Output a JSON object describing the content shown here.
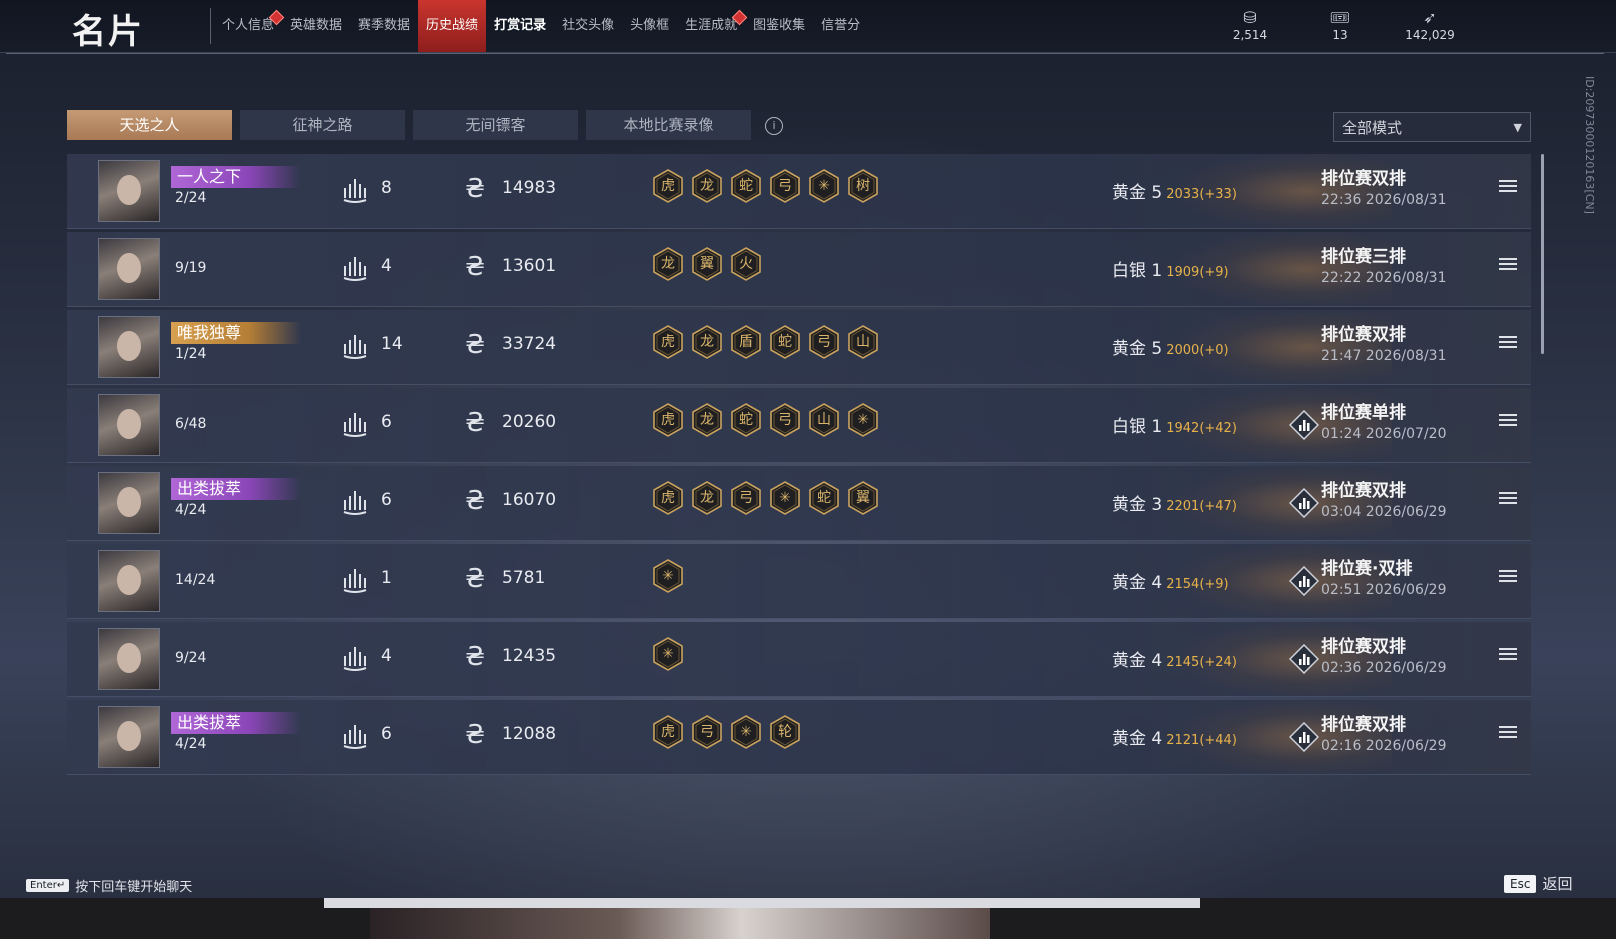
{
  "header": {
    "title": "名片",
    "nav": [
      {
        "label": "个人信息",
        "dot": true
      },
      {
        "label": "英雄数据",
        "dot": false
      },
      {
        "label": "赛季数据",
        "dot": false
      },
      {
        "label": "历史战绩",
        "dot": false,
        "active": true
      },
      {
        "label": "打赏记录",
        "dot": false
      },
      {
        "label": "社交头像",
        "dot": false
      },
      {
        "label": "头像框",
        "dot": false
      },
      {
        "label": "生涯成就",
        "dot": true
      },
      {
        "label": "图鉴收集",
        "dot": false
      },
      {
        "label": "信誉分",
        "dot": false
      }
    ],
    "currencies": [
      {
        "icon": "coin-icon",
        "value": "2,514"
      },
      {
        "icon": "ticket-icon",
        "value": "13"
      },
      {
        "icon": "feather-icon",
        "value": "142,029"
      }
    ]
  },
  "side_id": "ID:2097300012016​3[CN]",
  "tabs": [
    "天选之人",
    "征神之路",
    "无间镖客",
    "本地比赛录像"
  ],
  "mode_select": {
    "value": "全部模式"
  },
  "matches": [
    {
      "title": "一人之下",
      "title_style": "purple",
      "placement": "2/24",
      "kills": "8",
      "gold": "14983",
      "badges": [
        "虎",
        "龙",
        "蛇",
        "弓",
        "✳",
        "树"
      ],
      "rank": "黄金 5",
      "delta": "2033(+33)",
      "mode": "排位赛双排",
      "time": "22:36  2026/08/31",
      "stats": false
    },
    {
      "title": "",
      "title_style": "",
      "placement": "9/19",
      "kills": "4",
      "gold": "13601",
      "badges": [
        "龙",
        "翼",
        "火"
      ],
      "rank": "白银 1",
      "delta": "1909(+9)",
      "mode": "排位赛三排",
      "time": "22:22  2026/08/31",
      "stats": false
    },
    {
      "title": "唯我独尊",
      "title_style": "gold",
      "placement": "1/24",
      "kills": "14",
      "gold": "33724",
      "badges": [
        "虎",
        "龙",
        "盾",
        "蛇",
        "弓",
        "山"
      ],
      "rank": "黄金 5",
      "delta": "2000(+0)",
      "mode": "排位赛双排",
      "time": "21:47  2026/08/31",
      "stats": false
    },
    {
      "title": "",
      "title_style": "",
      "placement": "6/48",
      "kills": "6",
      "gold": "20260",
      "badges": [
        "虎",
        "龙",
        "蛇",
        "弓",
        "山",
        "✳"
      ],
      "rank": "白银 1",
      "delta": "1942(+42)",
      "mode": "排位赛单排",
      "time": "01:24  2026/07/20",
      "stats": true
    },
    {
      "title": "出类拔萃",
      "title_style": "purple",
      "placement": "4/24",
      "kills": "6",
      "gold": "16070",
      "badges": [
        "虎",
        "龙",
        "弓",
        "✳",
        "蛇",
        "翼"
      ],
      "rank": "黄金 3",
      "delta": "2201(+47)",
      "mode": "排位赛双排",
      "time": "03:04  2026/06/29",
      "stats": true
    },
    {
      "title": "",
      "title_style": "",
      "placement": "14/24",
      "kills": "1",
      "gold": "5781",
      "badges": [
        "✳"
      ],
      "rank": "黄金 4",
      "delta": "2154(+9)",
      "mode": "排位赛·双排",
      "time": "02:51  2026/06/29",
      "stats": true
    },
    {
      "title": "",
      "title_style": "",
      "placement": "9/24",
      "kills": "4",
      "gold": "12435",
      "badges": [
        "✳"
      ],
      "rank": "黄金 4",
      "delta": "2145(+24)",
      "mode": "排位赛双排",
      "time": "02:36  2026/06/29",
      "stats": true
    },
    {
      "title": "出类拔萃",
      "title_style": "purple",
      "placement": "4/24",
      "kills": "6",
      "gold": "12088",
      "badges": [
        "虎",
        "弓",
        "✳",
        "轮"
      ],
      "rank": "黄金 4",
      "delta": "2121(+44)",
      "mode": "排位赛双排",
      "time": "02:16  2026/06/29",
      "stats": true
    }
  ],
  "footer": {
    "enter_key": "Enter↵",
    "chat_hint": "按下回车键开始聊天",
    "esc_key": "Esc",
    "back_label": "返回"
  }
}
